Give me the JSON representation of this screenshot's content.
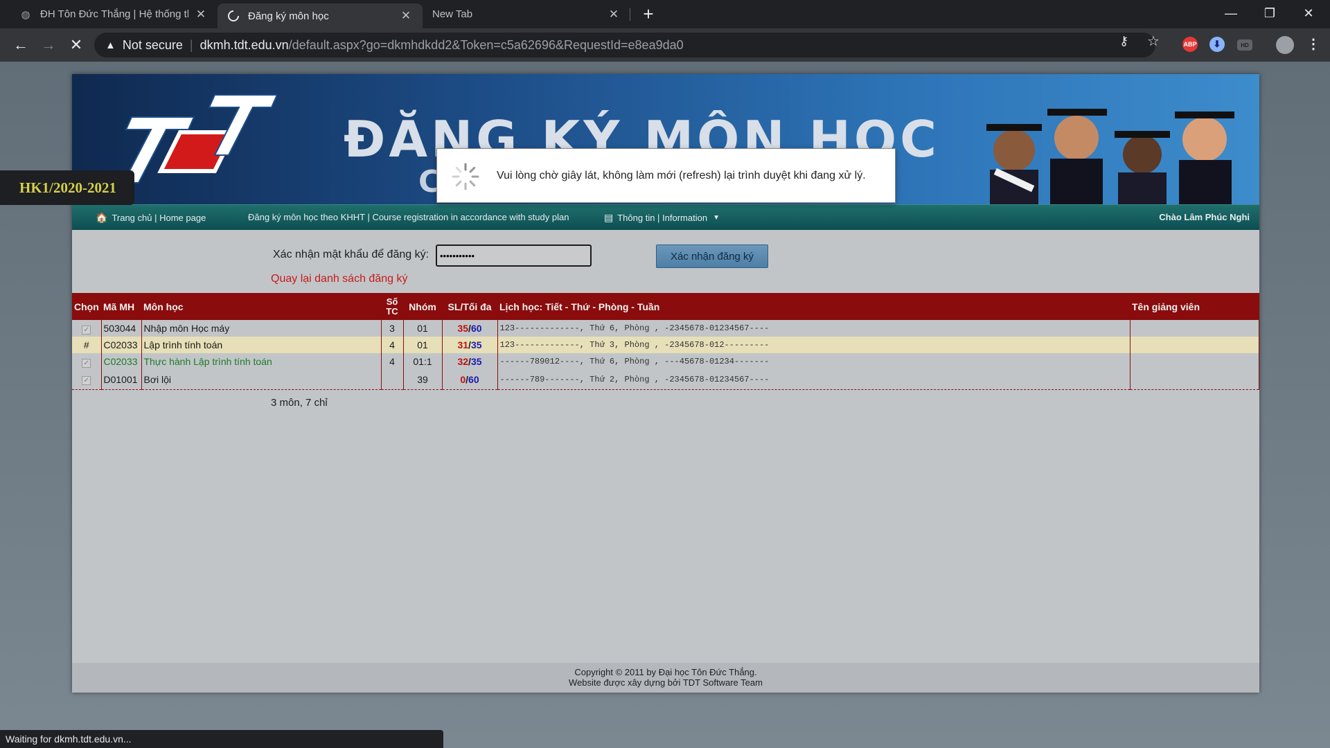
{
  "browser": {
    "tabs": [
      {
        "title": "ĐH Tôn Đức Thắng | Hệ thống th",
        "active": false
      },
      {
        "title": "Đăng ký môn học",
        "active": true
      },
      {
        "title": "New Tab",
        "active": false
      }
    ],
    "address": {
      "security": "Not secure",
      "host": "dkmh.tdt.edu.vn",
      "path": "/default.aspx?go=dkmhdkdd2&Token=c5a62696&RequestId=e8ea9da0"
    },
    "status": "Waiting for dkmh.tdt.edu.vn...",
    "extensions": {
      "abp": "ABP",
      "hd": "HD"
    }
  },
  "banner": {
    "title": "ĐĂNG KÝ MÔN HỌC",
    "subtitle_fragment": "C",
    "term": "HK1/2020-2021"
  },
  "nav": {
    "home": "Trang chủ | Home page",
    "register": "Đăng ký môn học theo KHHT | Course registration in accordance with study plan",
    "info": "Thông tin | Information",
    "greeting": "Chào Lâm Phúc Nghi"
  },
  "form": {
    "label": "Xác nhận mật khẩu để đăng ký:",
    "password_value": "•••••••••••",
    "button": "Xác nhận đăng ký",
    "back_link": "Quay lại danh sách đăng ký"
  },
  "table": {
    "headers": {
      "chon": "Chọn",
      "ma": "Mã MH",
      "mon": "Môn học",
      "so": "Số",
      "tc": "TC",
      "nhom": "Nhóm",
      "sl": "SL/Tối đa",
      "lich": "Lịch học: Tiết - Thứ - Phòng - Tuần",
      "gv": "Tên giảng viên"
    },
    "rows": [
      {
        "chon": "✓",
        "ma": "503044",
        "mon": "Nhập môn Học máy",
        "tc": "3",
        "nhom": "01",
        "sl_now": "35",
        "sl_max": "60",
        "lich": "123-------------, Thứ 6, Phòng      , -2345678-01234567----",
        "gv": ""
      },
      {
        "chon": "#",
        "ma": "C02033",
        "mon": "Lập trình tính toán",
        "tc": "4",
        "nhom": "01",
        "sl_now": "31",
        "sl_max": "35",
        "lich": "123-------------, Thứ 3, Phòng      , -2345678-012---------",
        "gv": ""
      },
      {
        "chon": "✓",
        "ma": "C02033",
        "mon": "Thực hành Lập trình tính toán",
        "tc": "4",
        "nhom": "01:1",
        "sl_now": "32",
        "sl_max": "35",
        "lich": "------789012----, Thứ 6, Phòng      , ---45678-01234-------",
        "gv": ""
      },
      {
        "chon": "✓",
        "ma": "D01001",
        "mon": "Bơi lội",
        "tc": "",
        "nhom": "39",
        "sl_now": "0",
        "sl_max": "60",
        "lich": "------789-------, Thứ 2, Phòng      , -2345678-01234567----",
        "gv": ""
      }
    ],
    "summary": "3 môn, 7 chỉ"
  },
  "footer": {
    "line1": "Copyright © 2011 by Đại học Tôn Đức Thắng.",
    "line2": "Website được xây dựng bởi TDT Software Team"
  },
  "modal": {
    "message": "Vui lòng chờ giây lát, không làm mới (refresh) lại trình duyệt khi đang xử lý."
  }
}
